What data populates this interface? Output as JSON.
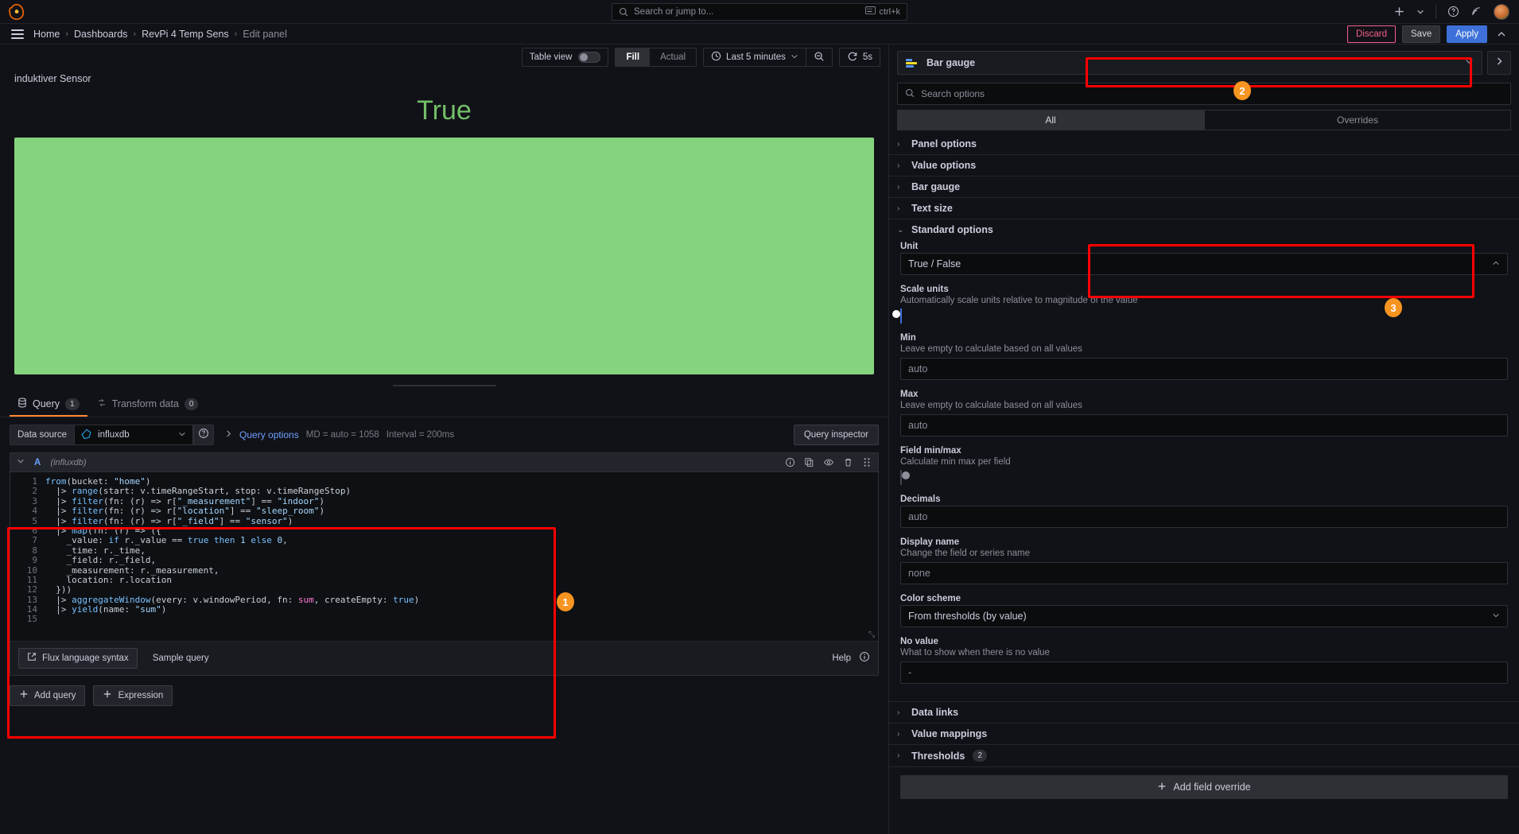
{
  "topnav": {
    "logo_icon": "grafana-logo-icon",
    "search": {
      "placeholder": "Search or jump to...",
      "icon": "search-icon",
      "shortcut": "ctrl+k",
      "kbd_icon": "keyboard-icon"
    },
    "plus_icon": "plus-icon",
    "plus_chevron_icon": "chevron-down-icon",
    "help_icon": "help-circle-icon",
    "news_icon": "rss-icon",
    "avatar_icon": "user-avatar"
  },
  "breadcrumb": {
    "menu_icon": "hamburger-menu-icon",
    "items": [
      {
        "label": "Home"
      },
      {
        "label": "Dashboards"
      },
      {
        "label": "RevPi 4 Temp Sens"
      },
      {
        "label": "Edit panel"
      }
    ],
    "separator": "›",
    "discard_label": "Discard",
    "save_label": "Save",
    "apply_label": "Apply",
    "collapse_icon": "chevron-up-icon"
  },
  "panel_toolbar": {
    "table_view_label": "Table view",
    "table_view_on": false,
    "fill_label": "Fill",
    "actual_label": "Actual",
    "fill_active": true,
    "time_range_label": "Last 5 minutes",
    "time_icon": "clock-icon",
    "time_chevron_icon": "chevron-down-icon",
    "zoom_out_icon": "zoom-out-icon",
    "refresh_icon": "refresh-icon",
    "refresh_interval": "5s"
  },
  "visualization": {
    "panel_title": "induktiver Sensor",
    "value_text": "True",
    "value_color": "#73bf69",
    "bar_color": "#86d37f"
  },
  "query_tabs": {
    "query_label": "Query",
    "query_count": "1",
    "query_icon": "database-icon",
    "transform_label": "Transform data",
    "transform_count": "0",
    "transform_icon": "transform-icon"
  },
  "datasource_row": {
    "label": "Data source",
    "selected": "influxdb",
    "datasource_icon": "influxdb-icon",
    "chevron_icon": "chevron-down-icon",
    "help_icon": "help-circle-icon",
    "query_options_label": "Query options",
    "query_options_caret": "chevron-right-icon",
    "md_text": "MD = auto = 1058",
    "interval_text": "Interval = 200ms",
    "query_inspector_label": "Query inspector"
  },
  "query_editor": {
    "caret_icon": "chevron-down-icon",
    "ref_id": "A",
    "datasource_name": "(influxdb)",
    "actions": [
      "info-circle-icon",
      "copy-icon",
      "eye-icon",
      "trash-icon",
      "drag-handle-icon"
    ],
    "code_lines": [
      {
        "n": "1",
        "tokens": [
          [
            "c-fn",
            "from"
          ],
          [
            "c-op",
            "(bucket: "
          ],
          [
            "c-str",
            "\"home\""
          ],
          [
            "c-op",
            ")"
          ]
        ]
      },
      {
        "n": "2",
        "tokens": [
          [
            "c-op",
            "  |> "
          ],
          [
            "c-fn",
            "range"
          ],
          [
            "c-op",
            "(start: v.timeRangeStart, stop: v.timeRangeStop)"
          ]
        ]
      },
      {
        "n": "3",
        "tokens": [
          [
            "c-op",
            "  |> "
          ],
          [
            "c-fn",
            "filter"
          ],
          [
            "c-op",
            "(fn: (r) => r["
          ],
          [
            "c-str",
            "\"_measurement\""
          ],
          [
            "c-op",
            "] == "
          ],
          [
            "c-str",
            "\"indoor\""
          ],
          [
            "c-op",
            ")"
          ]
        ]
      },
      {
        "n": "4",
        "tokens": [
          [
            "c-op",
            "  |> "
          ],
          [
            "c-fn",
            "filter"
          ],
          [
            "c-op",
            "(fn: (r) => r["
          ],
          [
            "c-str",
            "\"location\""
          ],
          [
            "c-op",
            "] == "
          ],
          [
            "c-str",
            "\"sleep_room\""
          ],
          [
            "c-op",
            ")"
          ]
        ]
      },
      {
        "n": "5",
        "tokens": [
          [
            "c-op",
            "  |> "
          ],
          [
            "c-fn",
            "filter"
          ],
          [
            "c-op",
            "(fn: (r) => r["
          ],
          [
            "c-str",
            "\"_field\""
          ],
          [
            "c-op",
            "] == "
          ],
          [
            "c-str",
            "\"sensor\""
          ],
          [
            "c-op",
            ")"
          ]
        ]
      },
      {
        "n": "6",
        "tokens": [
          [
            "c-op",
            "  |> "
          ],
          [
            "c-fn",
            "map"
          ],
          [
            "c-op",
            "(fn: (r) => ({"
          ]
        ]
      },
      {
        "n": "7",
        "tokens": [
          [
            "c-op",
            "    _value: "
          ],
          [
            "c-kw",
            "if"
          ],
          [
            "c-op",
            " r._value == "
          ],
          [
            "c-kw",
            "true"
          ],
          [
            "c-op",
            " "
          ],
          [
            "c-kw",
            "then"
          ],
          [
            "c-op",
            " "
          ],
          [
            "c-num",
            "1"
          ],
          [
            "c-op",
            " "
          ],
          [
            "c-kw",
            "else"
          ],
          [
            "c-op",
            " "
          ],
          [
            "c-num",
            "0"
          ],
          [
            "c-op",
            ","
          ]
        ]
      },
      {
        "n": "8",
        "tokens": [
          [
            "c-op",
            "    _time: r._time,"
          ]
        ]
      },
      {
        "n": "9",
        "tokens": [
          [
            "c-op",
            "    _field: r._field,"
          ]
        ]
      },
      {
        "n": "10",
        "tokens": [
          [
            "c-op",
            "    _measurement: r._measurement,"
          ]
        ]
      },
      {
        "n": "11",
        "tokens": [
          [
            "c-op",
            "    location: r.location"
          ]
        ]
      },
      {
        "n": "12",
        "tokens": [
          [
            "c-op",
            "  }))"
          ]
        ]
      },
      {
        "n": "13",
        "tokens": [
          [
            "c-op",
            "  |> "
          ],
          [
            "c-fn",
            "aggregateWindow"
          ],
          [
            "c-op",
            "(every: v.windowPeriod, fn: "
          ],
          [
            "c-pink",
            "sum"
          ],
          [
            "c-op",
            ", createEmpty: "
          ],
          [
            "c-kw",
            "true"
          ],
          [
            "c-op",
            ")"
          ]
        ]
      },
      {
        "n": "14",
        "tokens": [
          [
            "c-op",
            "  |> "
          ],
          [
            "c-fn",
            "yield"
          ],
          [
            "c-op",
            "(name: "
          ],
          [
            "c-str",
            "\"sum\""
          ],
          [
            "c-op",
            ")"
          ]
        ]
      },
      {
        "n": "15",
        "tokens": [
          [
            "c-op",
            ""
          ]
        ]
      }
    ],
    "flux_syntax_label": "Flux language syntax",
    "flux_syntax_icon": "external-link-icon",
    "sample_query_label": "Sample query",
    "help_label": "Help",
    "help_icon": "info-circle-icon",
    "add_query_label": "Add query",
    "add_expression_label": "Expression",
    "plus_icon": "plus-icon"
  },
  "options_pane": {
    "viz_name": "Bar gauge",
    "viz_icon": "bar-gauge-icon",
    "viz_chevron_icon": "chevron-down-icon",
    "viz_collapse_icon": "chevron-right-icon",
    "search_placeholder": "Search options",
    "search_icon": "search-icon",
    "tab_all": "All",
    "tab_overrides": "Overrides",
    "sections": [
      {
        "title": "Panel options",
        "expanded": false
      },
      {
        "title": "Value options",
        "expanded": false
      },
      {
        "title": "Bar gauge",
        "expanded": false
      },
      {
        "title": "Text size",
        "expanded": false
      }
    ],
    "standard_options": {
      "title": "Standard options",
      "expanded": true,
      "unit": {
        "label": "Unit",
        "value": "True / False",
        "chevron": "chevron-up-icon"
      },
      "scale_units": {
        "label": "Scale units",
        "desc": "Automatically scale units relative to magnitude of the value",
        "on": true
      },
      "min": {
        "label": "Min",
        "desc": "Leave empty to calculate based on all values",
        "placeholder": "auto"
      },
      "max": {
        "label": "Max",
        "desc": "Leave empty to calculate based on all values",
        "placeholder": "auto"
      },
      "field_minmax": {
        "label": "Field min/max",
        "desc": "Calculate min max per field",
        "on": false
      },
      "decimals": {
        "label": "Decimals",
        "placeholder": "auto"
      },
      "display_name": {
        "label": "Display name",
        "desc": "Change the field or series name",
        "placeholder": "none"
      },
      "color_scheme": {
        "label": "Color scheme",
        "value": "From thresholds (by value)",
        "chevron": "chevron-down-icon"
      },
      "no_value": {
        "label": "No value",
        "desc": "What to show when there is no value",
        "placeholder": "-"
      }
    },
    "bottom_sections": [
      {
        "title": "Data links",
        "count": ""
      },
      {
        "title": "Value mappings",
        "count": ""
      },
      {
        "title": "Thresholds",
        "count": "2"
      }
    ],
    "add_field_override_label": "Add field override",
    "add_field_override_icon": "plus-icon"
  },
  "annotations": [
    {
      "number": "1"
    },
    {
      "number": "2"
    },
    {
      "number": "3"
    }
  ],
  "colors": {
    "accent_blue": "#3d71d9",
    "accent_orange": "#ff8833",
    "green_value": "#73bf69",
    "green_bar": "#86d37f",
    "discard_pink": "#f55f8e",
    "annotation_red": "#ff0000",
    "annotation_orange": "#f89420"
  }
}
